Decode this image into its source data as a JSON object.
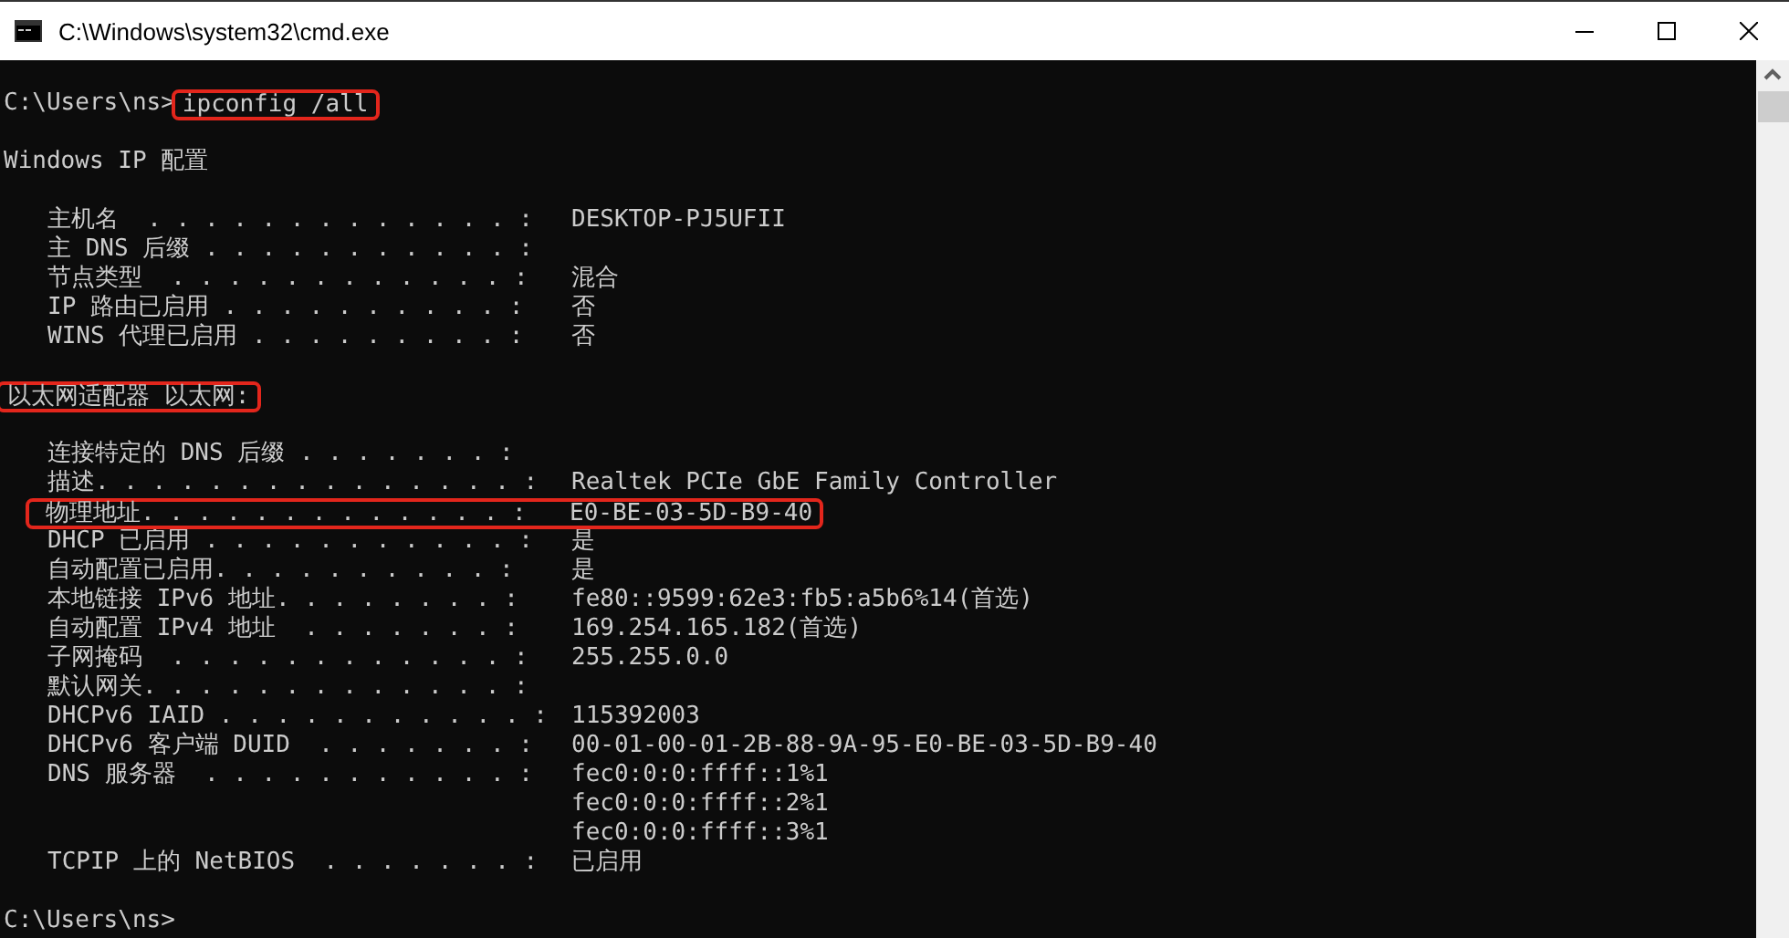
{
  "window": {
    "title": "C:\\Windows\\system32\\cmd.exe"
  },
  "console": {
    "sections": [
      {
        "lines": [
          {
            "kind": "prompt",
            "prompt": "C:\\Users\\ns>",
            "command": "ipconfig /all",
            "highlighted": true
          }
        ]
      },
      {
        "lines": [
          {
            "kind": "heading",
            "text": "Windows IP 配置",
            "highlighted": false
          }
        ]
      },
      {
        "lines": [
          {
            "kind": "entry",
            "label": "主机名  . . . . . . . . . . . . . :",
            "values": [
              "DESKTOP-PJ5UFII"
            ],
            "highlighted": false
          },
          {
            "kind": "entry",
            "label": "主 DNS 后缀 . . . . . . . . . . . :",
            "highlighted": false
          },
          {
            "kind": "entry",
            "label": "节点类型  . . . . . . . . . . . . :",
            "values": [
              "混合"
            ],
            "highlighted": false
          },
          {
            "kind": "entry",
            "label": "IP 路由已启用 . . . . . . . . . . :",
            "values": [
              "否"
            ],
            "highlighted": false
          },
          {
            "kind": "entry",
            "label": "WINS 代理已启用 . . . . . . . . . :",
            "values": [
              "否"
            ],
            "highlighted": false
          }
        ]
      },
      {
        "lines": [
          {
            "kind": "heading",
            "text": "以太网适配器 以太网:",
            "highlighted": true
          }
        ]
      },
      {
        "lines": [
          {
            "kind": "entry",
            "label": "连接特定的 DNS 后缀 . . . . . . . :",
            "highlighted": false
          },
          {
            "kind": "entry",
            "label": "描述. . . . . . . . . . . . . . . :",
            "values": [
              "Realtek PCIe GbE Family Controller"
            ],
            "highlighted": false
          },
          {
            "kind": "entry",
            "label": "物理地址. . . . . . . . . . . . . :",
            "values": [
              "E0-BE-03-5D-B9-40"
            ],
            "highlighted": true
          },
          {
            "kind": "entry",
            "label": "DHCP 已启用 . . . . . . . . . . . :",
            "values": [
              "是"
            ],
            "highlighted": false
          },
          {
            "kind": "entry",
            "label": "自动配置已启用. . . . . . . . . . :",
            "values": [
              "是"
            ],
            "highlighted": false
          },
          {
            "kind": "entry",
            "label": "本地链接 IPv6 地址. . . . . . . . :",
            "values": [
              "fe80::9599:62e3:fb5:a5b6%14(首选)"
            ],
            "highlighted": false
          },
          {
            "kind": "entry",
            "label": "自动配置 IPv4 地址  . . . . . . . :",
            "values": [
              "169.254.165.182(首选)"
            ],
            "highlighted": false
          },
          {
            "kind": "entry",
            "label": "子网掩码  . . . . . . . . . . . . :",
            "values": [
              "255.255.0.0"
            ],
            "highlighted": false
          },
          {
            "kind": "entry",
            "label": "默认网关. . . . . . . . . . . . . :",
            "highlighted": false
          },
          {
            "kind": "entry",
            "label": "DHCPv6 IAID . . . . . . . . . . . :",
            "values": [
              "115392003"
            ],
            "highlighted": false
          },
          {
            "kind": "entry",
            "label": "DHCPv6 客户端 DUID  . . . . . . . :",
            "values": [
              "00-01-00-01-2B-88-9A-95-E0-BE-03-5D-B9-40"
            ],
            "highlighted": false
          },
          {
            "kind": "entry",
            "label": "DNS 服务器  . . . . . . . . . . . :",
            "values": [
              "fec0:0:0:ffff::1%1",
              "fec0:0:0:ffff::2%1",
              "fec0:0:0:ffff::3%1"
            ],
            "highlighted": false
          },
          {
            "kind": "entry",
            "label": "TCPIP 上的 NetBIOS  . . . . . . . :",
            "values": [
              "已启用"
            ],
            "highlighted": false
          }
        ]
      },
      {
        "lines": [
          {
            "kind": "prompt",
            "prompt": "C:\\Users\\ns>",
            "highlighted": false
          }
        ]
      }
    ]
  }
}
